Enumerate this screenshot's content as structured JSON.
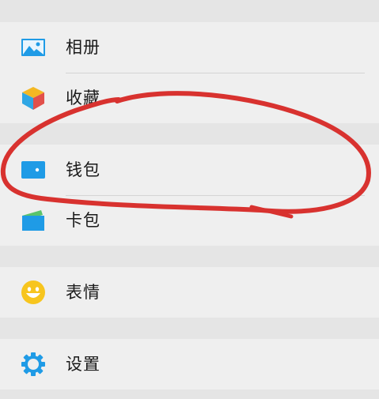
{
  "menu": {
    "album_label": "相册",
    "favorites_label": "收藏",
    "wallet_label": "钱包",
    "cards_label": "卡包",
    "stickers_label": "表情",
    "settings_label": "设置"
  },
  "colors": {
    "background": "#e5e5e5",
    "row_background": "#efefef",
    "icon_blue": "#1f9be6",
    "annotation_red": "#d8322f"
  },
  "icons": {
    "album": "picture-icon",
    "favorites": "cube-icon",
    "wallet": "wallet-icon",
    "cards": "card-pack-icon",
    "stickers": "smiley-icon",
    "settings": "gear-icon"
  }
}
